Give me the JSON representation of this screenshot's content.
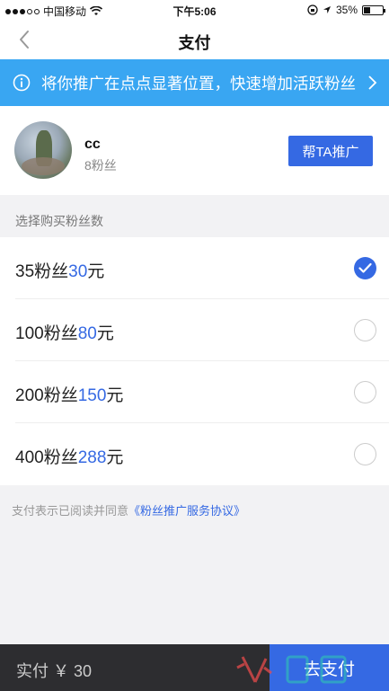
{
  "status_bar": {
    "carrier": "中国移动",
    "time": "下午5:06",
    "battery": "35%",
    "battery_level": 0.35
  },
  "nav": {
    "title": "支付"
  },
  "banner": {
    "text": "将你推广在点点显著位置，快速增加活跃粉丝"
  },
  "profile": {
    "name": "cc",
    "fans": "8粉丝",
    "promote_label": "帮TA推广"
  },
  "section_header": "选择购买粉丝数",
  "options": [
    {
      "count": "35粉丝",
      "price": "30",
      "unit": "元",
      "selected": true
    },
    {
      "count": "100粉丝",
      "price": "80",
      "unit": "元",
      "selected": false
    },
    {
      "count": "200粉丝",
      "price": "150",
      "unit": "元",
      "selected": false
    },
    {
      "count": "400粉丝",
      "price": "288",
      "unit": "元",
      "selected": false
    }
  ],
  "agreement": {
    "prefix": "支付表示已阅读并同意",
    "link": "《粉丝推广服务协议》"
  },
  "bottom": {
    "paid": "实付 ￥ 30",
    "pay_label": "去支付"
  },
  "colors": {
    "accent": "#3569e3",
    "banner": "#39a6f2",
    "bottom_bar": "#2d2d30"
  }
}
